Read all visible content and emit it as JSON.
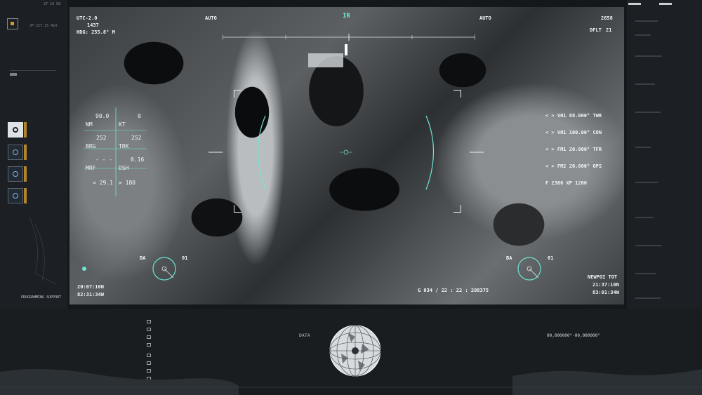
{
  "left_panel": {
    "header_code": "JP 227.15 414",
    "top_timestamps": "27    19    58",
    "programming_support_label": "PROGRAMMING SUPPORT"
  },
  "top_readouts": {
    "utc": "UTC-2.0",
    "utc_value": "1437",
    "heading": "HDG:  255.8° M",
    "auto_left": "AUTO",
    "mode": "IR",
    "auto_right": "AUTO",
    "right_value": "2658",
    "dflt_label": "DFLT",
    "dflt_value": "21"
  },
  "nav_table": {
    "row1": {
      "label_a": "NM",
      "value_a": "90.0",
      "label_b": "KT",
      "value_b": "0"
    },
    "row2": {
      "label_a": "BRG",
      "value_a": "252",
      "label_b": "TRK",
      "value_b": "252"
    },
    "row3": {
      "label_a": "MRF",
      "value_a": "- - -",
      "label_b": "DSH",
      "value_b": "0.16"
    },
    "row4": {
      "value_a": "< 29.1",
      "value_b": "> 180"
    }
  },
  "right_readouts": [
    {
      "label": "< > VH1",
      "value": "88.000°",
      "code": "TWR"
    },
    {
      "label": "< > VH1",
      "value": "100.00°",
      "code": "CON"
    },
    {
      "label": "< > FM1",
      "value": "20.000°",
      "code": "TFR"
    },
    {
      "label": "< > FM2",
      "value": "20.000°",
      "code": "OPS"
    }
  ],
  "fxp_line": "F   2306   XP   1200",
  "ba_left": {
    "label": "BA",
    "value": "01"
  },
  "ba_right": {
    "label": "BA",
    "value": "01"
  },
  "coords_left": {
    "lat": "20:07:10N",
    "lon": "82:31:34W"
  },
  "coords_center": "G 034 / 22 : 22 : 208375",
  "newpoi": {
    "label": "NEWPOI TOT",
    "time": "21:37:10N",
    "lon": "83:01:34W"
  },
  "bottom": {
    "data_label": "DATA",
    "coords_value": "00,000000°-00,000000°",
    "folder_items": [
      "",
      "",
      "",
      "",
      "",
      "",
      "",
      ""
    ]
  },
  "colors": {
    "accent": "#6fe5d3",
    "warning": "#b4842a"
  }
}
